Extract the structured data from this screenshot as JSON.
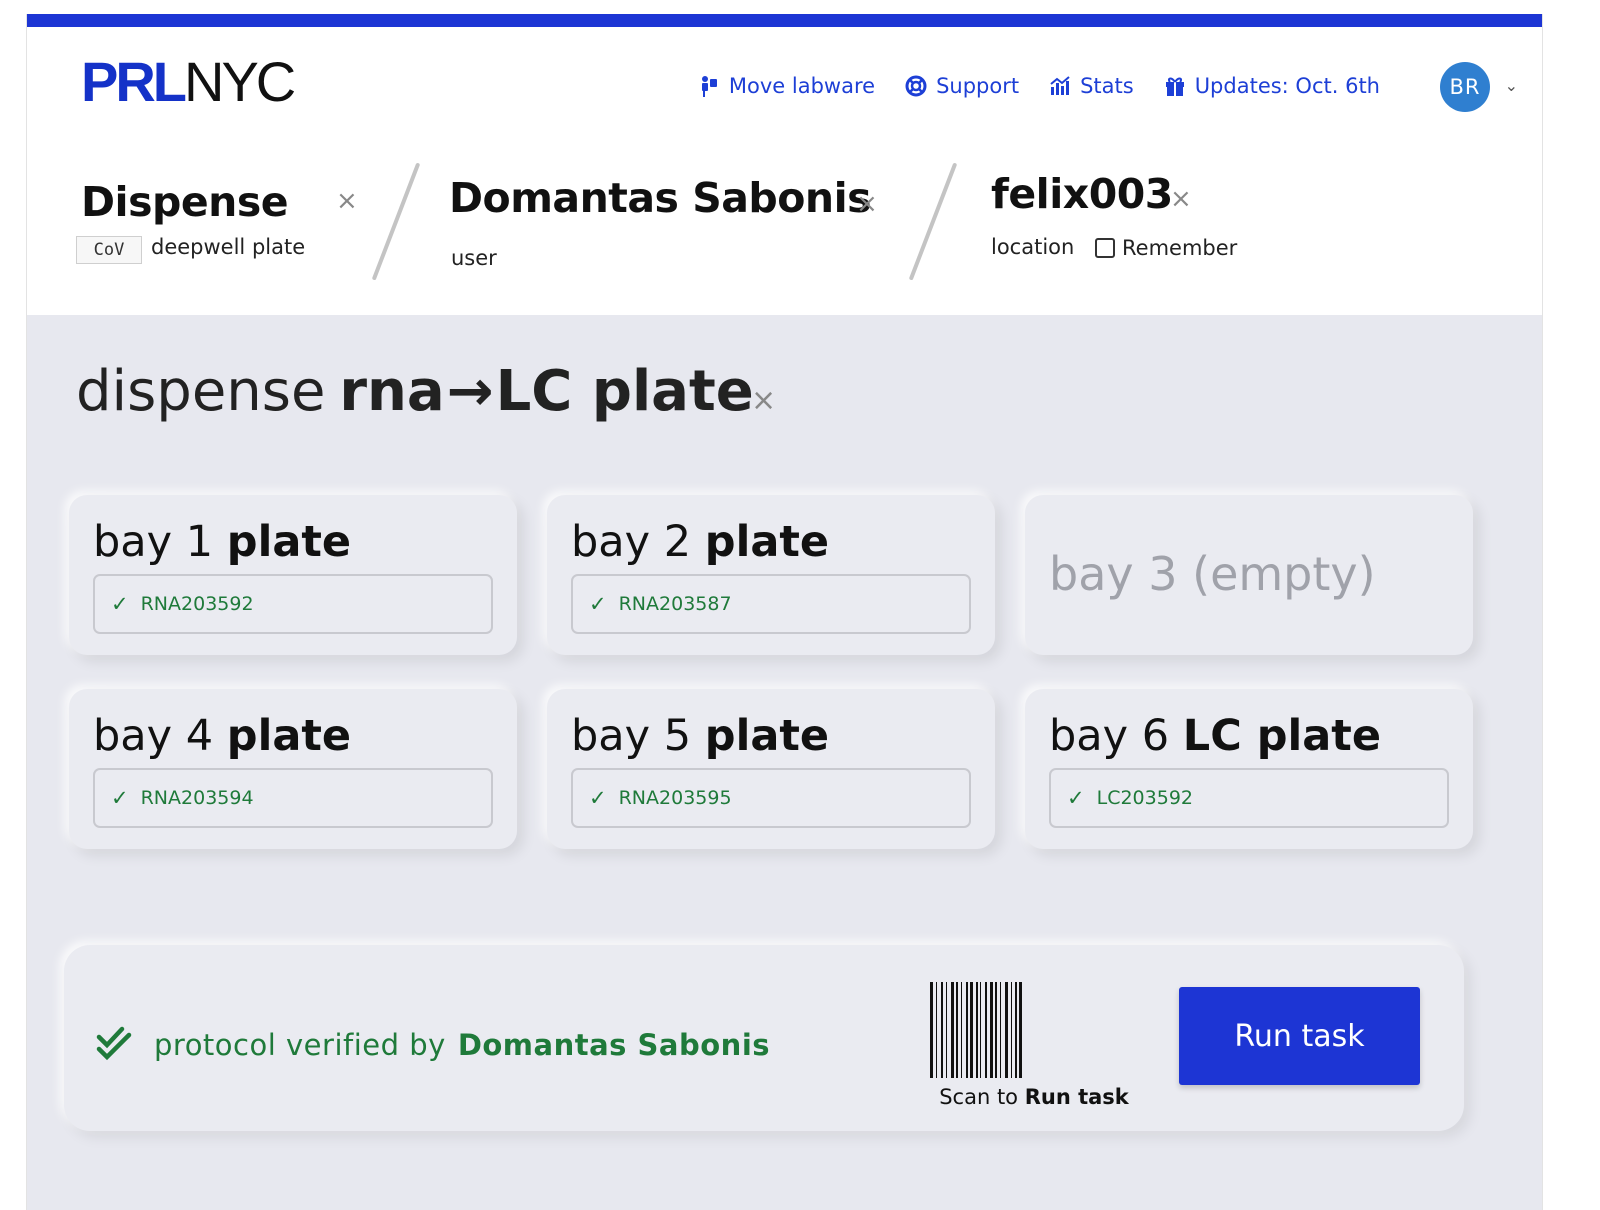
{
  "app": {
    "logo_bold": "PRL",
    "logo_light": "NYC",
    "accent_color": "#1d35d4"
  },
  "nav": {
    "items": [
      {
        "label": "Move labware",
        "icon": "person-dolly-icon"
      },
      {
        "label": "Support",
        "icon": "lifebuoy-icon"
      },
      {
        "label": "Stats",
        "icon": "bar-chart-icon"
      },
      {
        "label": "Updates: Oct. 6th",
        "icon": "gift-icon"
      }
    ],
    "avatar_initials": "BR"
  },
  "breadcrumb": {
    "protocol": {
      "title": "Dispense",
      "badge": "CoV",
      "subtitle": "deepwell plate"
    },
    "user": {
      "title": "Domantas Sabonis",
      "subtitle": "user"
    },
    "location": {
      "title": "felix003",
      "subtitle": "location",
      "remember_label": "Remember",
      "remember_checked": false
    }
  },
  "task": {
    "prefix": "dispense",
    "source": "rna",
    "arrow": "→",
    "dest": "LC plate"
  },
  "bays": [
    {
      "prefix": "bay 1",
      "kind": "plate",
      "barcode": "RNA203592",
      "verified": true
    },
    {
      "prefix": "bay 2",
      "kind": "plate",
      "barcode": "RNA203587",
      "verified": true
    },
    {
      "label": "bay 3 (empty)",
      "empty": true
    },
    {
      "prefix": "bay 4",
      "kind": "plate",
      "barcode": "RNA203594",
      "verified": true
    },
    {
      "prefix": "bay 5",
      "kind": "plate",
      "barcode": "RNA203595",
      "verified": true
    },
    {
      "prefix": "bay 6",
      "kind": "LC plate",
      "barcode": "LC203592",
      "verified": true
    }
  ],
  "footer": {
    "verified_prefix": "protocol verified by",
    "verified_by": "Domantas Sabonis",
    "scan_prefix": "Scan to",
    "scan_action": "Run task",
    "run_button": "Run task",
    "success_color": "#1f7a3a"
  }
}
